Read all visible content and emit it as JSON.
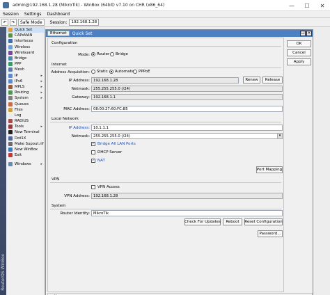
{
  "window": {
    "title": "admin@192.168.1.28 (MikroTik) - WinBox (64bit) v7.10 on CHR (x86_64)",
    "minimize": "—",
    "maximize": "☐",
    "close": "✕"
  },
  "menu": [
    "Session",
    "Settings",
    "Dashboard"
  ],
  "toolbar": {
    "undo": "↶",
    "redo": "↷",
    "safe_mode": "Safe Mode",
    "session_label": "Session:",
    "session_value": "192.168.1.28"
  },
  "rail_text": "RouterOS WinBox",
  "sidebar": {
    "items": [
      {
        "label": "Quick Set",
        "color": "#e2a040",
        "arrow": ""
      },
      {
        "label": "CAPsMAN",
        "color": "#5a8f4a",
        "arrow": ""
      },
      {
        "label": "Interfaces",
        "color": "#3a6fb0",
        "arrow": ""
      },
      {
        "label": "Wireless",
        "color": "#6aa0d8",
        "arrow": ""
      },
      {
        "label": "WireGuard",
        "color": "#7a4a9a",
        "arrow": ""
      },
      {
        "label": "Bridge",
        "color": "#4a8ab0",
        "arrow": ""
      },
      {
        "label": "PPP",
        "color": "#3a9a6a",
        "arrow": ""
      },
      {
        "label": "Mesh",
        "color": "#5a7ab0",
        "arrow": ""
      },
      {
        "label": "IP",
        "color": "#5a8ad0",
        "arrow": "▸"
      },
      {
        "label": "IPv6",
        "color": "#5a8ad0",
        "arrow": "▸"
      },
      {
        "label": "MPLS",
        "color": "#9a5a3a",
        "arrow": "▸"
      },
      {
        "label": "Routing",
        "color": "#4a9a4a",
        "arrow": "▸"
      },
      {
        "label": "System",
        "color": "#808080",
        "arrow": "▸"
      },
      {
        "label": "Queues",
        "color": "#d06a3a",
        "arrow": ""
      },
      {
        "label": "Files",
        "color": "#d0a03a",
        "arrow": ""
      },
      {
        "label": "Log",
        "color": "#eaeaea",
        "arrow": ""
      },
      {
        "label": "RADIUS",
        "color": "#b04a4a",
        "arrow": ""
      },
      {
        "label": "Tools",
        "color": "#9a3a3a",
        "arrow": "▸"
      },
      {
        "label": "New Terminal",
        "color": "#222222",
        "arrow": ""
      },
      {
        "label": "Dot1X",
        "color": "#4a6aa0",
        "arrow": ""
      },
      {
        "label": "Make Supout.rif",
        "color": "#6a6a6a",
        "arrow": ""
      },
      {
        "label": "New WinBox",
        "color": "#3a7ac0",
        "arrow": ""
      },
      {
        "label": "Exit",
        "color": "#c03a3a",
        "arrow": ""
      }
    ],
    "windows": {
      "label": "Windows",
      "color": "#6a8ab0",
      "arrow": "▸"
    }
  },
  "dialog": {
    "tab": "Ethernet",
    "title": "Quick Set",
    "restore": "☐",
    "close": "✕",
    "buttons": {
      "ok": "OK",
      "cancel": "Cancel",
      "apply": "Apply"
    },
    "configuration": {
      "heading": "Configuration",
      "mode_label": "Mode:",
      "mode_router": "Router",
      "mode_bridge": "Bridge"
    },
    "internet": {
      "heading": "Internet",
      "acq_label": "Address Acquisition:",
      "acq_static": "Static",
      "acq_automatic": "Automatic",
      "acq_pppoe": "PPPoE",
      "ip_label": "IP Address:",
      "ip_value": "192.168.1.28",
      "renew": "Renew",
      "release": "Release",
      "netmask_label": "Netmask:",
      "netmask_value": "255.255.255.0 (/24)",
      "gateway_label": "Gateway:",
      "gateway_value": "192.168.1.1",
      "mac_label": "MAC Address:",
      "mac_value": "08:00:27:60:FC:B5"
    },
    "local": {
      "heading": "Local Network",
      "ip_label": "IP Address:",
      "ip_value": "10.1.1.1",
      "netmask_label": "Netmask:",
      "netmask_value": "255.255.255.0 (/24)",
      "bridge_ports": "Bridge All LAN Ports",
      "dhcp": "DHCP Server",
      "nat": "NAT",
      "port_mapping": "Port Mapping"
    },
    "vpn": {
      "heading": "VPN",
      "access": "VPN Access",
      "address_label": "VPN Address:",
      "address_value": "192.168.1.28"
    },
    "system": {
      "heading": "System",
      "identity_label": "Router Identity:",
      "identity_value": "MikroTik",
      "check_updates": "Check For Updates",
      "reboot": "Reboot",
      "reset": "Reset Configuration",
      "password": "Password..."
    },
    "status": "active"
  }
}
